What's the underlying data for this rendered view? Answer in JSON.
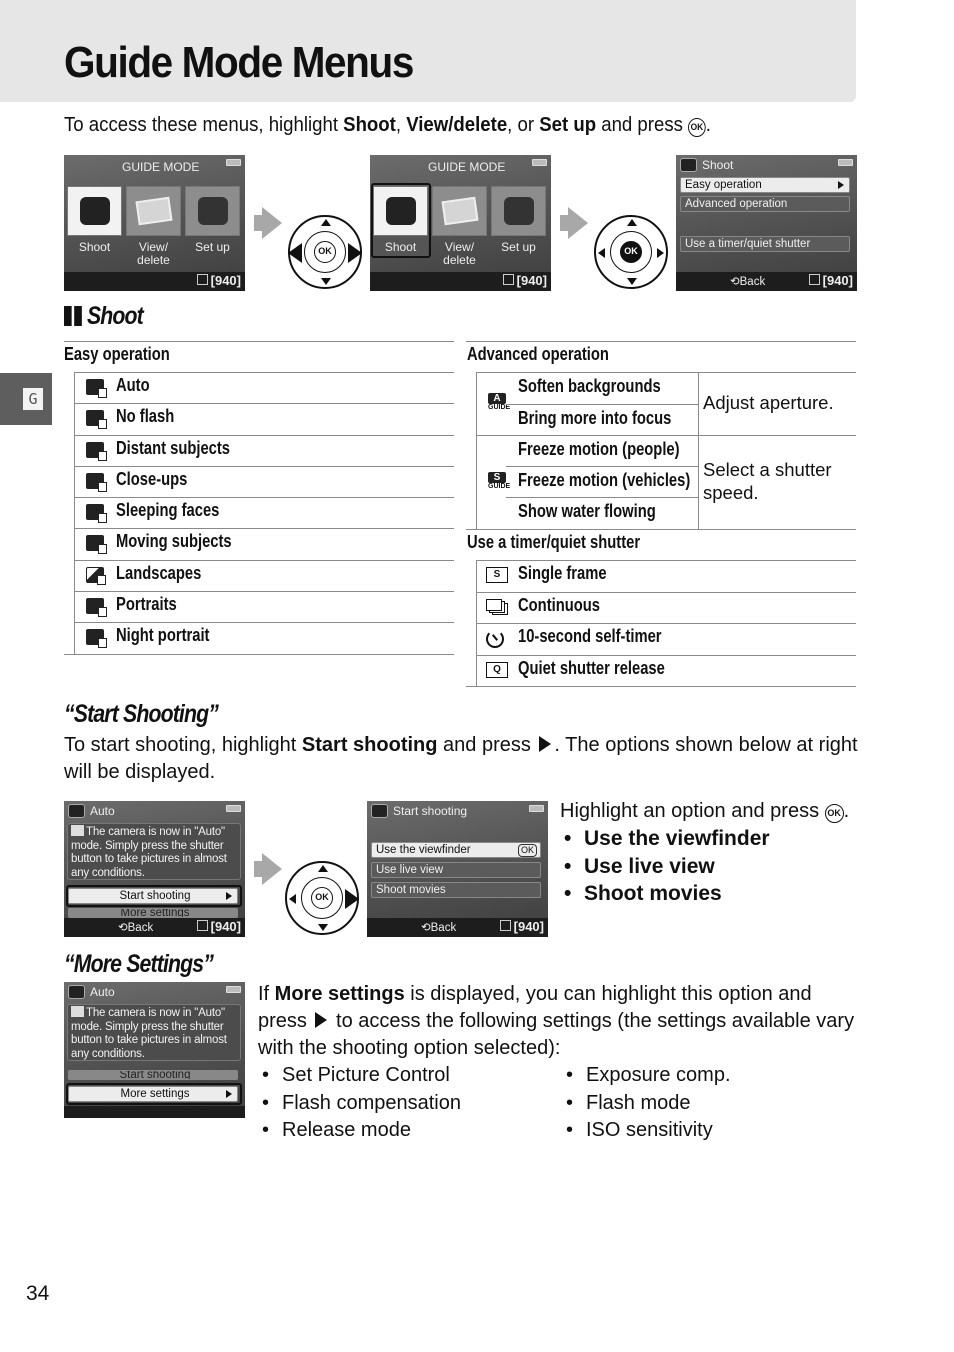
{
  "header": {
    "title": "Guide Mode Menus",
    "intro_prefix": "To access these menus, highlight ",
    "intro_bold1": "Shoot",
    "intro_sep1": ", ",
    "intro_bold2": "View/delete",
    "intro_sep2": ", or ",
    "intro_bold3": "Set up",
    "intro_suffix": " and press ",
    "intro_end": ".",
    "ok_glyph": "OK"
  },
  "side_tab": {
    "label": "G"
  },
  "screens_top": {
    "guide_mode_title": "GUIDE MODE",
    "tiles": [
      {
        "label": "Shoot"
      },
      {
        "label": "View/\ndelete"
      },
      {
        "label": "Set up"
      }
    ],
    "shoot_menu": {
      "title": "Shoot",
      "items": [
        "Easy operation",
        "Advanced operation",
        "Use a timer/quiet shutter"
      ]
    },
    "shots_remaining": "[940]",
    "back_label": "Back",
    "dpad_ok": "OK"
  },
  "shoot_section": {
    "heading": "Shoot",
    "easy": {
      "header": "Easy operation",
      "items": [
        {
          "icon": "auto-mode-icon",
          "label": "Auto"
        },
        {
          "icon": "no-flash-mode-icon",
          "label": "No flash"
        },
        {
          "icon": "distant-subjects-icon",
          "label": "Distant subjects"
        },
        {
          "icon": "close-ups-icon",
          "label": "Close-ups"
        },
        {
          "icon": "sleeping-faces-icon",
          "label": "Sleeping faces"
        },
        {
          "icon": "moving-subjects-icon",
          "label": "Moving subjects"
        },
        {
          "icon": "landscapes-icon",
          "label": "Landscapes"
        },
        {
          "icon": "portraits-icon",
          "label": "Portraits"
        },
        {
          "icon": "night-portrait-icon",
          "label": "Night portrait"
        }
      ]
    },
    "advanced": {
      "header": "Advanced operation",
      "groups": [
        {
          "icon_letter": "A",
          "icon_sub": "GUIDE",
          "items": [
            "Soften backgrounds",
            "Bring more into focus"
          ],
          "description": "Adjust aperture."
        },
        {
          "icon_letter": "S",
          "icon_sub": "GUIDE",
          "items": [
            "Freeze motion (people)",
            "Freeze motion (vehicles)",
            "Show water flowing"
          ],
          "description": "Select a shutter speed."
        }
      ]
    },
    "timer": {
      "header": "Use a timer/quiet shutter",
      "items": [
        {
          "icon": "single-frame-icon",
          "glyph": "S",
          "label": "Single frame"
        },
        {
          "icon": "continuous-icon",
          "glyph": "",
          "label": "Continuous"
        },
        {
          "icon": "self-timer-icon",
          "glyph": "",
          "label": "10-second self-timer"
        },
        {
          "icon": "quiet-shutter-icon",
          "glyph": "Q",
          "label": "Quiet shutter release"
        }
      ]
    }
  },
  "start_shooting": {
    "heading": "“Start Shooting”",
    "text_prefix": "To start shooting, highlight ",
    "text_bold": "Start shooting",
    "text_mid": " and press ",
    "text_suffix": ".  The options shown below at right will be displayed.",
    "auto_screen": {
      "title": "Auto",
      "message": "The camera is now in \"Auto\" mode. Simply press the shutter button to take pictures in almost any conditions.",
      "start_label": "Start shooting",
      "more_label": "More settings"
    },
    "options_screen": {
      "title": "Start shooting",
      "items": [
        "Use the viewfinder",
        "Use live view",
        "Shoot movies"
      ],
      "ok_mark": "OK"
    },
    "instruction_prefix": "Highlight an option and press ",
    "instruction_suffix": ".",
    "options": [
      "Use the viewfinder",
      "Use live view",
      "Shoot movies"
    ]
  },
  "more_settings": {
    "heading": "“More Settings”",
    "text_prefix": "If ",
    "text_bold": "More settings",
    "text_mid": " is displayed, you can highlight this option and press ",
    "text_suffix": " to access the following settings (the settings available vary with the shooting option selected):",
    "left_list": [
      "Set Picture Control",
      "Flash compensation",
      "Release mode"
    ],
    "right_list": [
      "Exposure comp.",
      "Flash mode",
      "ISO sensitivity"
    ]
  },
  "footer": {
    "page_number": "34"
  }
}
